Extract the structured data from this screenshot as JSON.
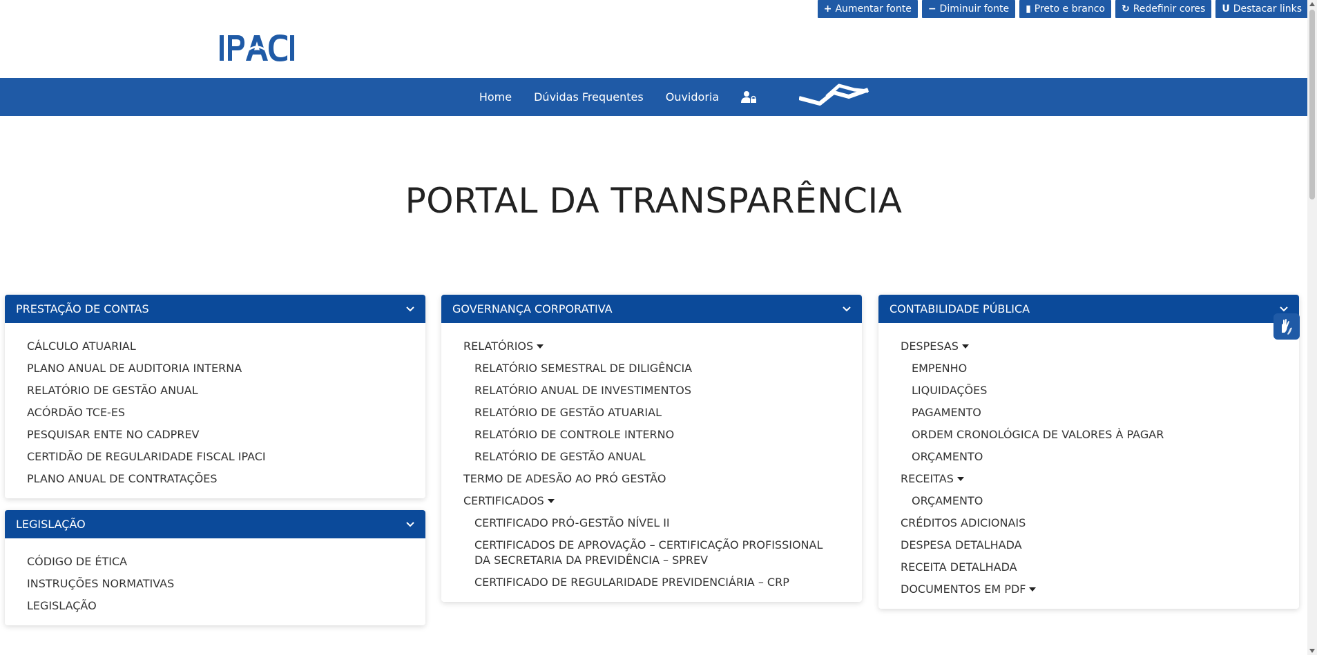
{
  "accessibility": {
    "increase": "Aumentar fonte",
    "decrease": "Diminuir fonte",
    "grayscale": "Preto e branco",
    "reset": "Redefinir cores",
    "links": "Destacar links"
  },
  "logo": {
    "text": "IPACI"
  },
  "nav": {
    "home": "Home",
    "faq": "Dúvidas Frequentes",
    "ombudsman": "Ouvidoria"
  },
  "page_title": "PORTAL DA TRANSPARÊNCIA",
  "colors": {
    "primary": "#1f5aa6",
    "panel_header": "#0b4a9a"
  },
  "panels": {
    "prestacao": {
      "title": "PRESTAÇÃO DE CONTAS",
      "items": [
        "CÁLCULO ATUARIAL",
        "PLANO ANUAL DE AUDITORIA INTERNA",
        "RELATÓRIO DE GESTÃO ANUAL",
        "ACÓRDÃO TCE-ES",
        "PESQUISAR ENTE NO CADPREV",
        "CERTIDÃO DE REGULARIDADE FISCAL IPACI",
        "PLANO ANUAL DE CONTRATAÇÕES"
      ]
    },
    "legislacao": {
      "title": "LEGISLAÇÃO",
      "items": [
        "CÓDIGO DE ÉTICA",
        "INSTRUÇÕES NORMATIVAS",
        "LEGISLAÇÃO"
      ]
    },
    "governanca": {
      "title": "GOVERNANÇA CORPORATIVA",
      "relatorios": "RELATÓRIOS",
      "relatorios_items": [
        "RELATÓRIO SEMESTRAL DE DILIGÊNCIA",
        "RELATÓRIO ANUAL DE INVESTIMENTOS",
        "RELATÓRIO DE GESTÃO ATUARIAL",
        "RELATÓRIO DE CONTROLE INTERNO",
        "RELATÓRIO DE GESTÃO ANUAL"
      ],
      "termo": "TERMO DE ADESÃO AO PRÓ GESTÃO",
      "certificados": "CERTIFICADOS",
      "certificados_items": [
        "CERTIFICADO PRÓ-GESTÃO NÍVEL II",
        "CERTIFICADOS DE APROVAÇÃO – CERTIFICAÇÃO PROFISSIONAL DA SECRETARIA DA PREVIDÊNCIA – SPREV",
        "CERTIFICADO DE REGULARIDADE PREVIDENCIÁRIA – CRP"
      ]
    },
    "contabilidade": {
      "title": "CONTABILIDADE PÚBLICA",
      "despesas": "DESPESAS",
      "despesas_items": [
        "EMPENHO",
        "LIQUIDAÇÕES",
        "PAGAMENTO",
        "ORDEM CRONOLÓGICA DE VALORES À PAGAR",
        "ORÇAMENTO"
      ],
      "receitas": "RECEITAS",
      "receitas_items": [
        "ORÇAMENTO"
      ],
      "creditos": "CRÉDITOS ADICIONAIS",
      "despesa_detalhada": "DESPESA DETALHADA",
      "receita_detalhada": "RECEITA DETALHADA",
      "documentos": "DOCUMENTOS EM PDF"
    }
  }
}
